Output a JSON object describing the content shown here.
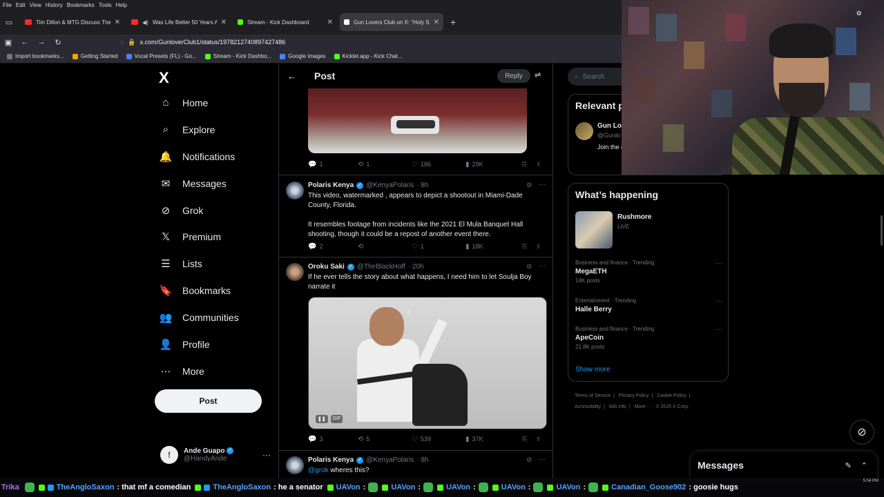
{
  "browser": {
    "menu": [
      "File",
      "Edit",
      "View",
      "History",
      "Bookmarks",
      "Tools",
      "Help"
    ],
    "tabs": [
      {
        "title": "Tim Dillon & MTG Discuss The E",
        "favicon": "youtube",
        "active": false
      },
      {
        "title": "Was Life Better 50 Years Ag",
        "favicon": "youtube",
        "active": false
      },
      {
        "title": "Stream - Kick Dashboard",
        "favicon": "kick",
        "active": false
      },
      {
        "title": "Gun Lovers Club on X: \"Holy Sh",
        "favicon": "x",
        "active": true
      }
    ],
    "url": "x.com/GunloverClub1/status/1978212740897427486",
    "bookmarks": [
      "Import bookmarks...",
      "Getting Started",
      "Vocal Presets (FL) - Go...",
      "Stream - Kick Dashbo...",
      "Google Images",
      "Kicklet.app - Kick Chat..."
    ]
  },
  "sidebar": {
    "logo": "X",
    "items": [
      {
        "label": "Home",
        "icon": "home-icon",
        "glyph": "⌂"
      },
      {
        "label": "Explore",
        "icon": "search-icon",
        "glyph": "⌕"
      },
      {
        "label": "Notifications",
        "icon": "bell-icon",
        "glyph": "🔔"
      },
      {
        "label": "Messages",
        "icon": "mail-icon",
        "glyph": "✉"
      },
      {
        "label": "Grok",
        "icon": "grok-icon",
        "glyph": "⊘"
      },
      {
        "label": "Premium",
        "icon": "x-icon",
        "glyph": "𝕏"
      },
      {
        "label": "Lists",
        "icon": "list-icon",
        "glyph": "☰"
      },
      {
        "label": "Bookmarks",
        "icon": "bookmark-icon",
        "glyph": "🔖"
      },
      {
        "label": "Communities",
        "icon": "communities-icon",
        "glyph": "👥"
      },
      {
        "label": "Profile",
        "icon": "person-icon",
        "glyph": "👤"
      },
      {
        "label": "More",
        "icon": "more-icon",
        "glyph": "⋯"
      }
    ],
    "post_label": "Post",
    "account": {
      "name": "Ande Guapo",
      "handle": "@HandyAnde",
      "avatar_glyph": "!"
    }
  },
  "main": {
    "header_title": "Post",
    "reply_label": "Reply",
    "top_actions": {
      "replies": "1",
      "reposts": "1",
      "likes": "186",
      "views": "29K"
    },
    "tweets": [
      {
        "name": "Polaris Kenya",
        "handle": "@KenyaPolaris",
        "time": "· 8h",
        "text1": "This video, watermarked , appears to depict a shootout in Miami-Dade County, Florida.",
        "text2": "It resembles footage from incidents like the 2021 El Mula Banquet Hall shooting, though it could be a repost of another event there.",
        "replies": "2",
        "reposts": "",
        "likes": "1",
        "views": "18K"
      },
      {
        "name": "Oroku Saki",
        "handle": "@TheBlackHoff",
        "time": "· 20h",
        "text1": "If he ever tells the story about what happens, I need him to let Soulja Boy narrate it",
        "gif_label": "GIF",
        "replies": "3",
        "reposts": "5",
        "likes": "539",
        "views": "37K"
      },
      {
        "name": "Polaris Kenya",
        "handle": "@KenyaPolaris",
        "time": "· 8h",
        "mention": "@grok",
        "text1": " wheres this?"
      }
    ]
  },
  "right": {
    "search_placeholder": "Search",
    "relevant": {
      "title": "Relevant p",
      "name": "Gun Lov",
      "handle": "@Gunlo",
      "bio": "Join the epic pic removal"
    },
    "happening": {
      "title": "What’s happening",
      "event": {
        "title": "Rushmore",
        "status": "LIVE"
      },
      "trends": [
        {
          "category": "Business and finance · Trending",
          "name": "MegaETH",
          "count": "14K posts"
        },
        {
          "category": "Entertainment · Trending",
          "name": "Halle Berry",
          "count": ""
        },
        {
          "category": "Business and finance · Trending",
          "name": "ApeCoin",
          "count": "21.8K posts"
        }
      ],
      "show_more": "Show more"
    },
    "footer": [
      "Terms of Service",
      "|",
      "Privacy Policy",
      "|",
      "Cookie Policy",
      "|",
      "Accessibility",
      "|",
      "Ads info",
      "|",
      "More ···",
      "© 2025 X Corp."
    ]
  },
  "overlay": {
    "messages_title": "Messages",
    "chat": [
      {
        "user": "Trika",
        "text": "",
        "color": "#9d7bff"
      },
      {
        "user": "TheAngloSaxon",
        "text": ": that mf a comedian",
        "color": "#4fa3ff"
      },
      {
        "user": "TheAngloSaxon",
        "text": ": he a senator",
        "color": "#4fa3ff"
      },
      {
        "user": "UAVon",
        "text": ":",
        "color": "#4fa3ff"
      },
      {
        "user": "UAVon",
        "text": ":",
        "color": "#4fa3ff"
      },
      {
        "user": "UAVon",
        "text": ":",
        "color": "#4fa3ff"
      },
      {
        "user": "UAVon",
        "text": ":",
        "color": "#4fa3ff"
      },
      {
        "user": "UAVon",
        "text": ":",
        "color": "#4fa3ff"
      },
      {
        "user": "Canadian_Goose902",
        "text": ": goosie hugs",
        "color": "#4fa3ff"
      }
    ],
    "clock": "5:04 PM"
  }
}
